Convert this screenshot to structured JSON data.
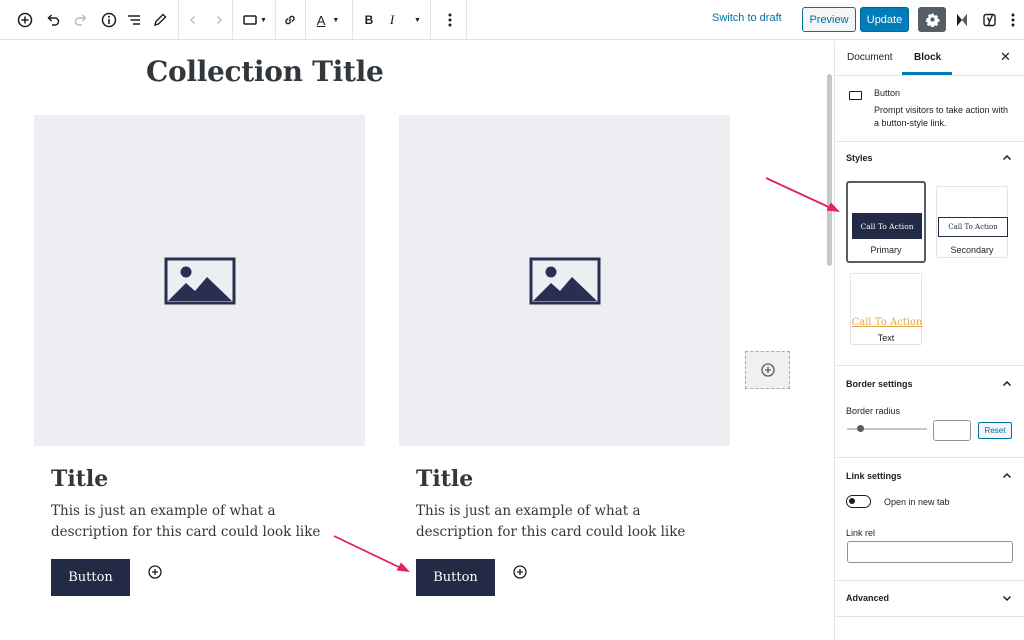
{
  "toolbar": {
    "switch_to_draft": "Switch to draft",
    "preview": "Preview",
    "update": "Update",
    "bold": "B",
    "italic": "I",
    "text_color": "A"
  },
  "editor": {
    "collection_title": "Collection Title",
    "cards": [
      {
        "title": "Title",
        "description": "This is just an example of what a description for this card could look like",
        "button": "Button"
      },
      {
        "title": "Title",
        "description": "This is just an example of what a description for this card could look like",
        "button": "Button"
      }
    ]
  },
  "sidebar": {
    "tabs": [
      "Document",
      "Block"
    ],
    "active_tab": "Block",
    "block": {
      "name": "Button",
      "description": "Prompt visitors to take action with a button-style link."
    },
    "styles": {
      "heading": "Styles",
      "options": [
        {
          "label": "Primary",
          "preview": "Call To Action",
          "selected": true
        },
        {
          "label": "Secondary",
          "preview": "Call To Action",
          "selected": false
        },
        {
          "label": "Text",
          "preview": "Call To Action",
          "selected": false
        }
      ]
    },
    "border_settings": {
      "heading": "Border settings",
      "radius_label": "Border radius",
      "radius_value": "",
      "reset": "Reset"
    },
    "link_settings": {
      "heading": "Link settings",
      "open_new_tab": "Open in new tab",
      "open_new_tab_on": false,
      "link_rel_label": "Link rel",
      "link_rel_value": ""
    },
    "advanced": {
      "heading": "Advanced"
    }
  },
  "colors": {
    "accent": "#007cba",
    "button_dark": "#232a45",
    "annotation_arrow": "#e0245e",
    "text_style_link": "#e0a54a"
  }
}
